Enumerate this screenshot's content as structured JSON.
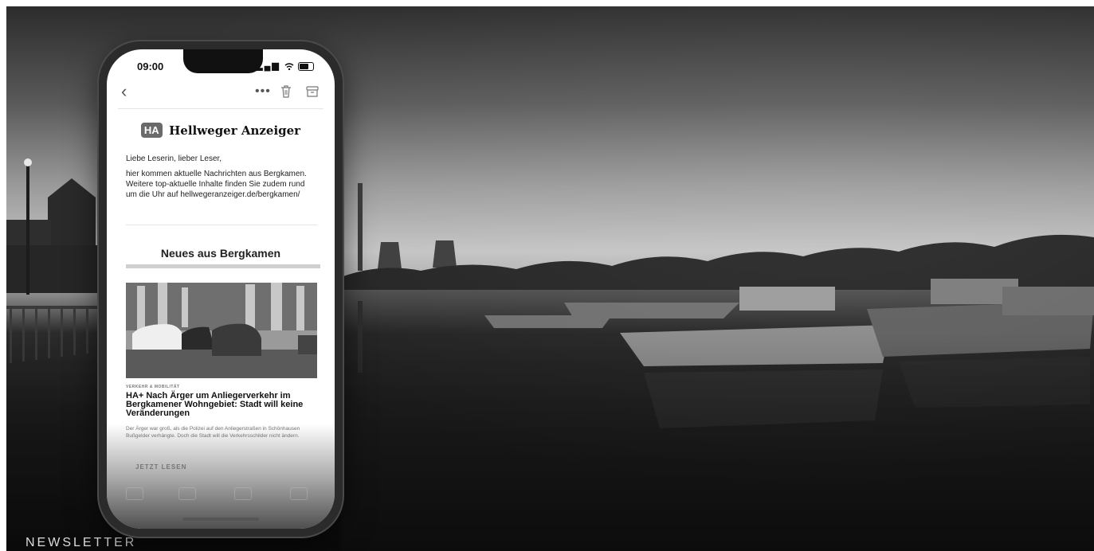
{
  "hero": {
    "kicker": "NEWSLETTER"
  },
  "phone": {
    "status": {
      "time": "09:00",
      "signal": "▂▄▆"
    },
    "toolbar": {
      "back_icon": "‹",
      "more_icon": "•••"
    },
    "masthead": {
      "badge": "HA",
      "name": "Hellweger Anzeiger"
    },
    "greeting": "Liebe Leserin, lieber Leser,",
    "intro": "hier kommen aktuelle Nachrichten aus Bergkamen. Weitere top-aktuelle Inhalte finden Sie zudem rund um die Uhr auf hellwegeranzeiger.de/bergkamen/",
    "section_title": "Neues aus Bergkamen",
    "article": {
      "category": "VERKEHR & MOBILITÄT",
      "headline": "HA+ Nach Ärger um Anliegerverkehr im Bergkamener Wohngebiet: Stadt will keine Veränderungen",
      "teaser": "Der Ärger war groß, als die Polizei auf den Anliegerstraßen in Schönhausen Bußgelder verhängte. Doch die Stadt will die Verkehrsschilder nicht ändern.",
      "cta": "JETZT LESEN"
    }
  }
}
